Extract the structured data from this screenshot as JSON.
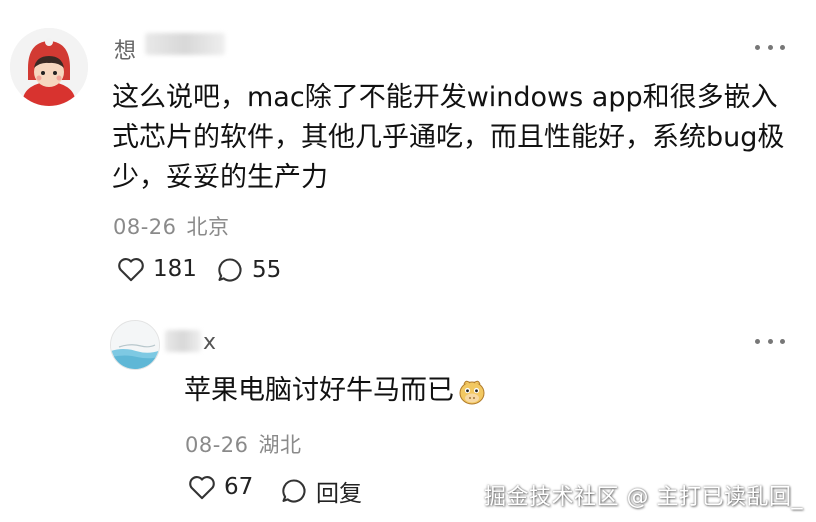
{
  "comment": {
    "username_visible": "想",
    "avatar_icon": "cartoon-child-avatar",
    "text": "这么说吧，mac除了不能开发windows app和很多嵌入式芯片的软件，其他几乎通吃，而且性能好，系统bug极少，妥妥的生产力",
    "date": "08-26",
    "location": "北京",
    "likes": "181",
    "comments": "55"
  },
  "reply": {
    "username_visible": "x",
    "avatar_icon": "water-landscape-avatar",
    "text": "苹果电脑讨好牛马而已",
    "emoji_icon": "cow-face-emoji",
    "date": "08-26",
    "location": "湖北",
    "likes": "67",
    "reply_label": "回复"
  },
  "watermark": "掘金技术社区 @ 主打已读乱回_",
  "colors": {
    "text": "#111111",
    "meta": "#8a8a8a",
    "icon": "#333333"
  }
}
